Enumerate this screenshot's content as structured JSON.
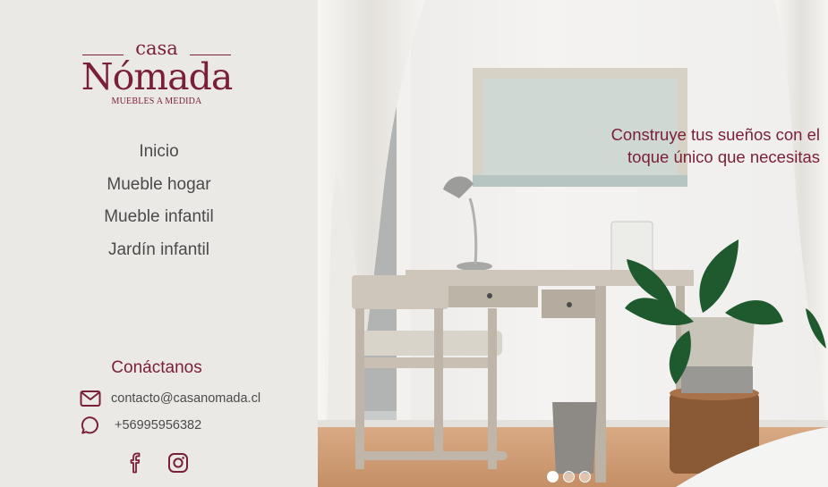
{
  "brand": {
    "top": "casa",
    "name": "Nómada",
    "tagline": "MUEBLES A MEDIDA",
    "color": "#7a1f38"
  },
  "nav": {
    "items": [
      {
        "label": "Inicio"
      },
      {
        "label": "Mueble hogar"
      },
      {
        "label": "Mueble infantil"
      },
      {
        "label": "Jardín infantil"
      }
    ]
  },
  "contact": {
    "title": "Conáctanos",
    "email": "contacto@casanomada.cl",
    "email_icon": "mail-icon",
    "phone": "+56995956382",
    "phone_icon": "chat-bubble-icon"
  },
  "social": {
    "items": [
      {
        "icon": "facebook-icon"
      },
      {
        "icon": "instagram-icon"
      }
    ]
  },
  "hero": {
    "line1": "Construye tus sueños con el",
    "line2": "toque único que necesitas",
    "slides_total": 3,
    "active_slide": 1
  }
}
